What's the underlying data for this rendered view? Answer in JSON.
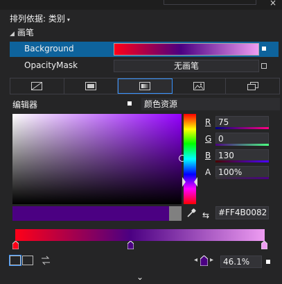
{
  "window": {
    "close_glyph": "×"
  },
  "sort": {
    "label": "排列依据: 类别",
    "caret": "▾"
  },
  "section": {
    "title": "画笔",
    "toggle": "◢"
  },
  "brushes": [
    {
      "name": "Background",
      "selected": true
    },
    {
      "name": "OpacityMask",
      "value": "无画笔"
    }
  ],
  "tabs": [
    {
      "icon": "no-brush-icon"
    },
    {
      "icon": "solid-brush-icon"
    },
    {
      "icon": "gradient-brush-icon",
      "active": true
    },
    {
      "icon": "tile-brush-icon"
    },
    {
      "icon": "resource-brush-icon"
    }
  ],
  "editor": {
    "label": "编辑器",
    "resources": "颜色资源"
  },
  "color": {
    "r_label": "R",
    "r": "75",
    "g_label": "G",
    "g": "0",
    "b_label": "B",
    "b": "130",
    "a_label": "A",
    "a": "100%",
    "hex": "#FF4B0082",
    "swap_glyph": "⇆",
    "preview": "#4b0082"
  },
  "gradient": {
    "stops": [
      {
        "color": "#ff0018",
        "offset": 0
      },
      {
        "color": "#4b0082",
        "offset": 0.461
      },
      {
        "color": "#ee9cf2",
        "offset": 1
      }
    ],
    "offset_text": "46.1%",
    "nav_left": "◂",
    "nav_right": "▸"
  },
  "expand": {
    "glyph": "⌄"
  }
}
